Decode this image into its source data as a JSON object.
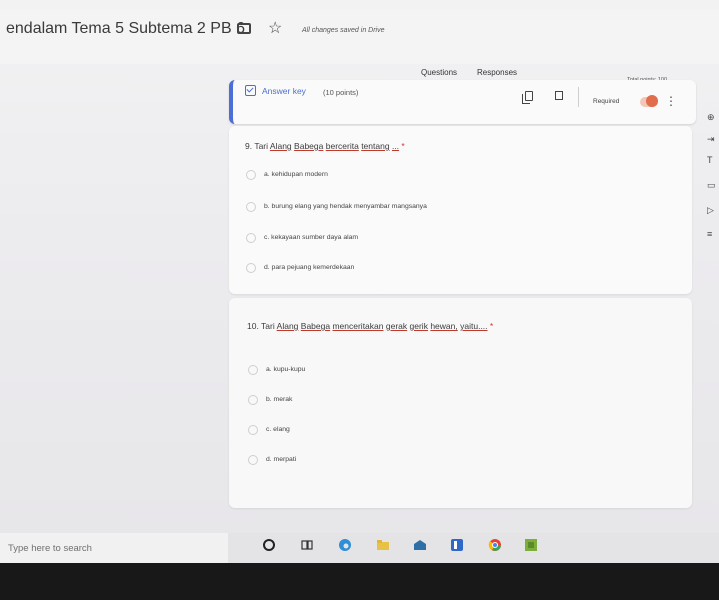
{
  "header": {
    "title": "endalam Tema 5 Subtema 2 PB 6",
    "saved_status": "All changes saved in Drive"
  },
  "tabs": {
    "questions": "Questions",
    "responses": "Responses"
  },
  "total_points": "Total points: 100",
  "answer_key": {
    "label": "Answer key",
    "points": "(10 points)",
    "required_label": "Required"
  },
  "question9": {
    "number": "9.",
    "text_prefix": "Tari",
    "underlined": [
      "Alang",
      "Babega",
      "bercerita",
      "tentang",
      "..."
    ],
    "options": [
      "a. kehidupan modern",
      "b. burung elang yang hendak menyambar mangsanya",
      "c. kekayaan sumber daya alam",
      "d. para pejuang kemerdekaan"
    ]
  },
  "question10": {
    "number": "10.",
    "text_prefix": "Tari",
    "underlined": [
      "Alang",
      "Babega",
      "menceritakan",
      "gerak",
      "gerik",
      "hewan,",
      "yaitu...."
    ],
    "options": [
      "a. kupu-kupu",
      "b. merak",
      "c. elang",
      "d. merpati"
    ]
  },
  "required_mark": "*",
  "taskbar": {
    "search_placeholder": "Type here to search"
  },
  "colors": {
    "accent": "#4b6fd6",
    "toggle": "#e06d4c",
    "required": "#d93025"
  },
  "icons": [
    "folder-icon",
    "star-icon",
    "check-icon",
    "copy-icon",
    "trash-icon",
    "more-icon",
    "cortana-icon",
    "task-view-icon",
    "edge-icon",
    "file-explorer-icon",
    "store-icon",
    "app-icon",
    "chrome-icon",
    "minecraft-icon"
  ]
}
